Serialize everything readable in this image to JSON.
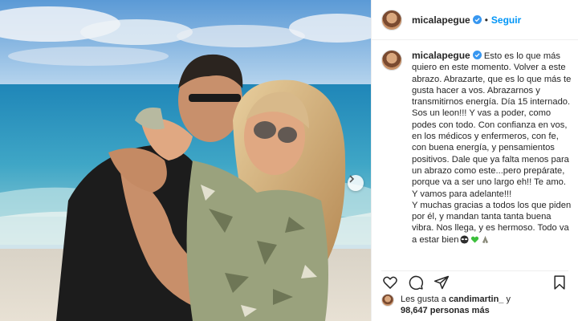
{
  "post": {
    "username": "micalapegue",
    "follow_label": "Seguir",
    "separator": "•",
    "caption": "Esto es lo que más quiero en este momento. Volver a este abrazo. Abrazarte, que es lo que más te gusta hacer a vos. Abrazarnos y transmitirnos energía. Día 15 internado. Sos un leon!!! Y vas a poder, como podes con todo. Con confianza en vos, en los médicos y enfermeros, con fe, con buena energía, y pensamientos positivos. Dale que ya falta menos para un abrazo como este...pero prepárate, porque va a ser uno largo eh!! Te amo. Y vamos para adelante!!!\nY muchas gracias a todos los que piden por él, y mandan tanta tanta buena vibra. Nos llega, y es hermoso. Todo va a estar bien",
    "caption_emojis": [
      "sunglasses-emoji",
      "green-heart-emoji",
      "praying-hands-emoji"
    ]
  },
  "likes": {
    "prefix": "Les gusta a",
    "liker": "candimartin_",
    "connector": "y",
    "count": "98,647",
    "suffix": "personas más"
  },
  "icons": {
    "verified_color": "#3897f0",
    "follow_color": "#0095f6"
  }
}
